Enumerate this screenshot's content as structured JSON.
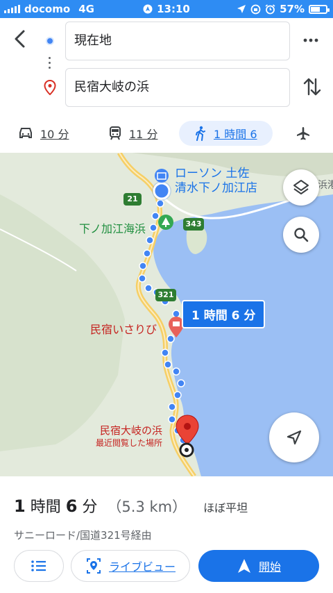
{
  "status_bar": {
    "carrier": "docomo",
    "network": "4G",
    "time": "13:10",
    "battery": "57%"
  },
  "header": {
    "origin": "現在地",
    "destination": "民宿大岐の浜"
  },
  "modes": [
    {
      "icon": "car-icon",
      "label": "10 分"
    },
    {
      "icon": "train-icon",
      "label": "11 分"
    },
    {
      "icon": "walk-icon",
      "label": "1 時間 6",
      "active": true
    },
    {
      "icon": "plane-icon",
      "label": ""
    }
  ],
  "map": {
    "poi_lawson": "ローソン 土佐清水下ノ加江店",
    "poi_lawson_line1": "ローソン 土佐",
    "poi_lawson_line2": "清水下ノ加江店",
    "poi_beach": "下ノ加江海浜",
    "poi_inn_isaribi": "民宿いさりび",
    "poi_destination": "民宿大岐の浜",
    "poi_destination_sub": "最近閲覧した場所",
    "poi_port_fragment": "浜港",
    "route_badge": "1 時間 6 分",
    "road_shields": [
      "21",
      "343",
      "321"
    ]
  },
  "summary": {
    "duration_num1": "1",
    "duration_unit1": " 時間 ",
    "duration_num2": "6",
    "duration_unit2": " 分",
    "distance": "（5.3 km）",
    "terrain": "ほぼ平坦",
    "via": "サニーロード/国道321号経由"
  },
  "buttons": {
    "live_view": "ライブビュー",
    "start": "開始"
  },
  "colors": {
    "accent": "#1a73e8",
    "status_bar": "#2e8cf3",
    "water": "#9bbff4",
    "land": "#e3eadc",
    "destination_red": "#c5221f"
  }
}
